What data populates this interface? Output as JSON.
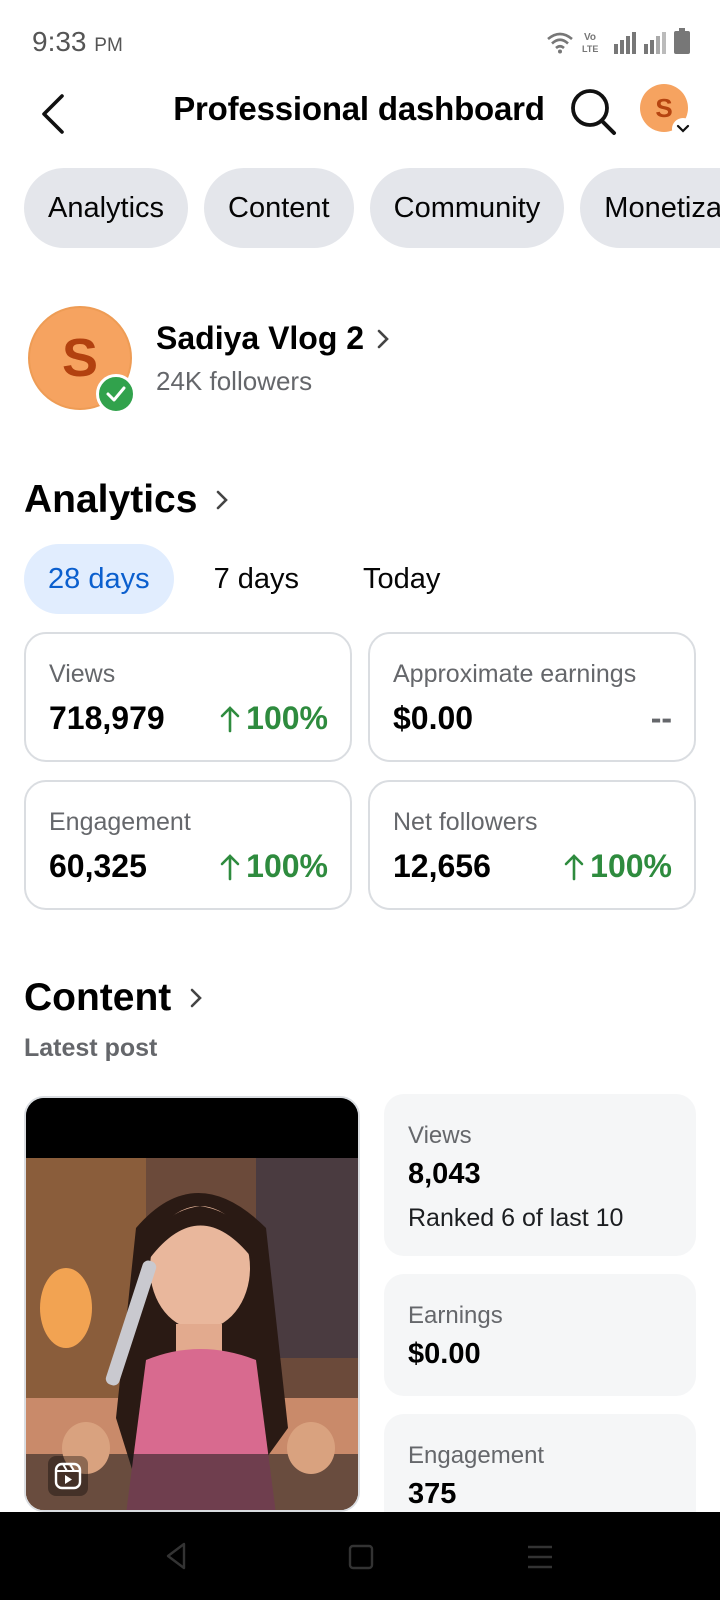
{
  "status_bar": {
    "time": "9:33",
    "ampm": "PM",
    "icons": [
      "wifi-icon",
      "volte-icon",
      "signal-icon",
      "signal-icon",
      "battery-icon"
    ]
  },
  "header": {
    "title": "Professional dashboard",
    "icons": [
      "back-arrow-icon",
      "search-icon",
      "avatar",
      "chevron-down-icon"
    ],
    "avatar_initial": "S"
  },
  "tabs": [
    "Analytics",
    "Content",
    "Community",
    "Monetization"
  ],
  "profile": {
    "initial": "S",
    "name": "Sadiya Vlog 2",
    "followers": "24K followers"
  },
  "analytics": {
    "heading": "Analytics",
    "ranges": [
      "28 days",
      "7 days",
      "Today"
    ],
    "active_range": "28 days",
    "cards": [
      {
        "label": "Views",
        "value": "718,979",
        "change": "100%"
      },
      {
        "label": "Approximate earnings",
        "value": "$0.00",
        "change": "--"
      },
      {
        "label": "Engagement",
        "value": "60,325",
        "change": "100%"
      },
      {
        "label": "Net followers",
        "value": "12,656",
        "change": "100%"
      }
    ]
  },
  "content": {
    "heading": "Content",
    "subheading": "Latest post",
    "stats": [
      {
        "label": "Views",
        "value": "8,043",
        "sub": "Ranked 6 of last 10"
      },
      {
        "label": "Earnings",
        "value": "$0.00"
      },
      {
        "label": "Engagement",
        "value": "375"
      }
    ]
  },
  "colors": {
    "accent_blue": "#0b5fce",
    "positive_green": "#2e8b3e",
    "chip_gray": "#e4e6eb",
    "avatar_orange": "#f6a360"
  }
}
